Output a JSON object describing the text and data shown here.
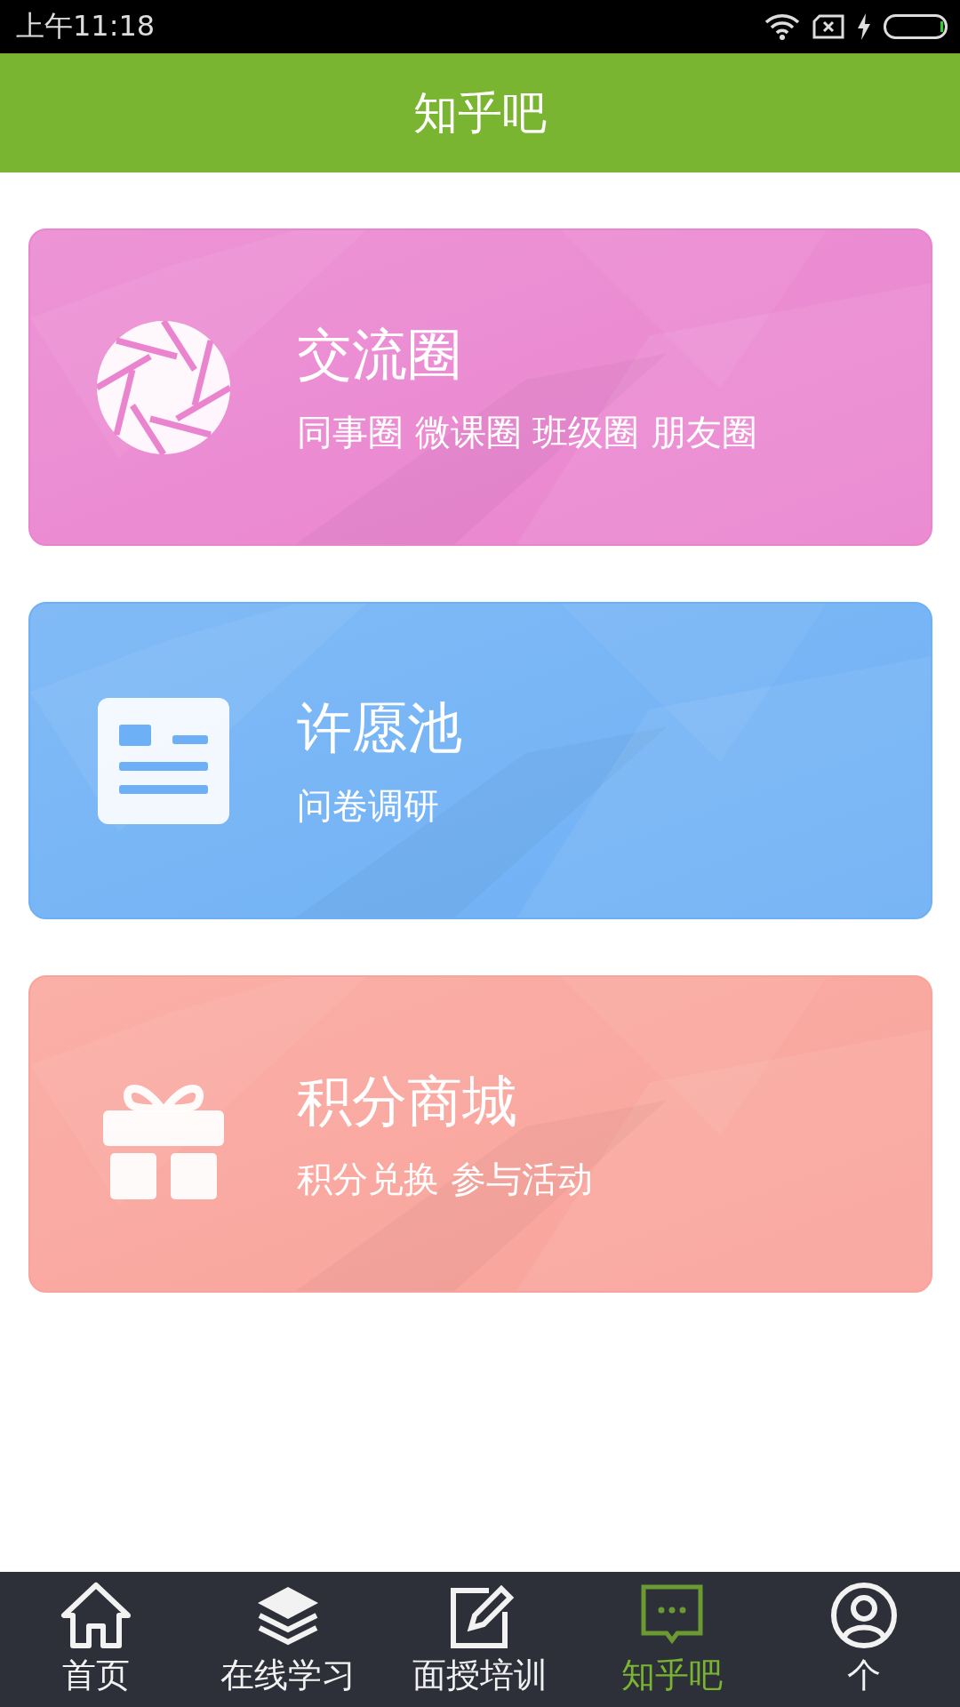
{
  "status_bar": {
    "time": "上午11:18"
  },
  "header": {
    "title": "知乎吧"
  },
  "cards": [
    {
      "kind": "aperture",
      "title": "交流圈",
      "subtitle": "同事圈 微课圈 班级圈 朋友圈",
      "color": "#ea84cf"
    },
    {
      "kind": "document",
      "title": "许愿池",
      "subtitle": "问卷调研",
      "color": "#6eb0f5"
    },
    {
      "kind": "gift",
      "title": "积分商城",
      "subtitle": "积分兑换 参与活动",
      "color": "#f9a39a"
    }
  ],
  "tabs": [
    {
      "kind": "home",
      "label": "首页",
      "selected": false
    },
    {
      "kind": "layers",
      "label": "在线学习",
      "selected": false
    },
    {
      "kind": "edit",
      "label": "面授培训",
      "selected": false
    },
    {
      "kind": "chat",
      "label": "知乎吧",
      "selected": true
    },
    {
      "kind": "user",
      "label": "个",
      "selected": false
    }
  ]
}
